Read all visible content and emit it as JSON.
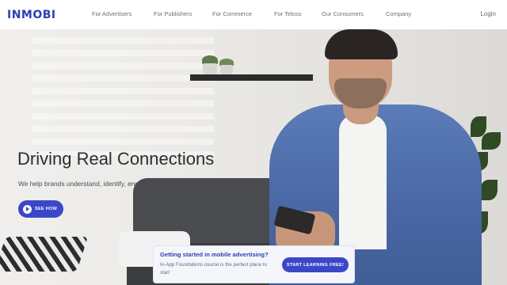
{
  "header": {
    "logo_text": "INMOBI",
    "nav_items": [
      "For Advertisers",
      "For Publishers",
      "For Commerce",
      "For Telcos",
      "Our Consumers",
      "Company"
    ],
    "login_label": "Login"
  },
  "hero": {
    "title": "Driving Real Connections",
    "subtitle": "We help brands understand, identify, engage and acquire consumers.",
    "cta_label": "SEE HOW"
  },
  "promo": {
    "title": "Getting started in mobile advertising?",
    "text": "In-App Foundations course is the perfect place to start",
    "button_label": "START LEARNING FREE!"
  },
  "icons": {
    "play": "play-icon"
  },
  "colors": {
    "brand": "#3b47c9",
    "logo": "#2f3fb0"
  }
}
